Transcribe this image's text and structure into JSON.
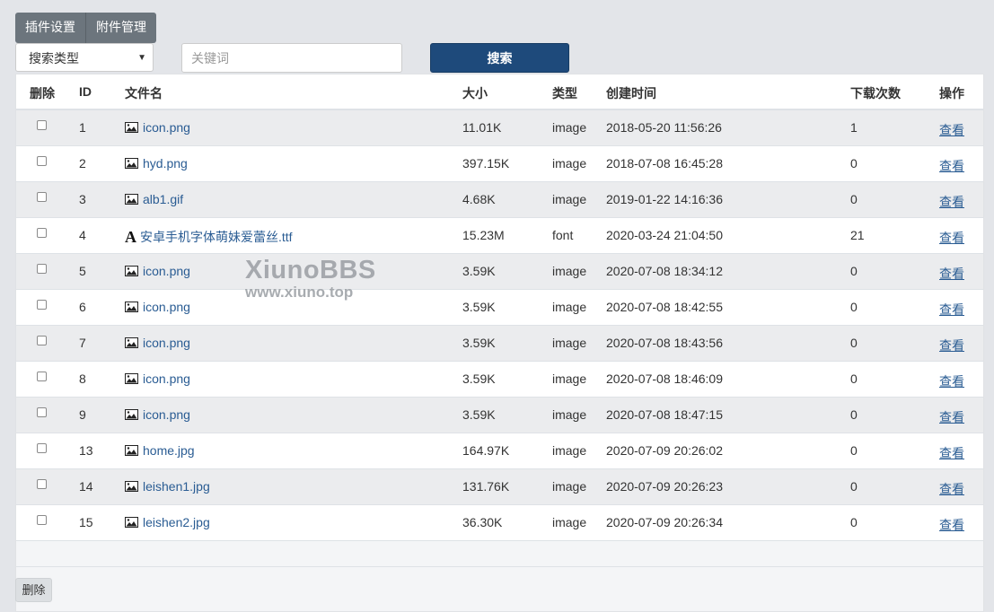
{
  "tabs": [
    "插件设置",
    "附件管理"
  ],
  "search": {
    "type_value": "搜索类型",
    "keyword_placeholder": "关键词",
    "button_label": "搜索"
  },
  "columns": [
    "删除",
    "ID",
    "文件名",
    "大小",
    "类型",
    "创建时间",
    "下载次数",
    "操作"
  ],
  "rows": [
    {
      "id": "1",
      "icon": "image-icon",
      "name": "icon.png",
      "size": "11.01K",
      "type": "image",
      "created": "2018-05-20 11:56:26",
      "downloads": "1",
      "action": "查看"
    },
    {
      "id": "2",
      "icon": "image-icon",
      "name": "hyd.png",
      "size": "397.15K",
      "type": "image",
      "created": "2018-07-08 16:45:28",
      "downloads": "0",
      "action": "查看"
    },
    {
      "id": "3",
      "icon": "image-icon",
      "name": "alb1.gif",
      "size": "4.68K",
      "type": "image",
      "created": "2019-01-22 14:16:36",
      "downloads": "0",
      "action": "查看"
    },
    {
      "id": "4",
      "icon": "font-icon",
      "name": "安卓手机字体萌妹爱蕾丝.ttf",
      "size": "15.23M",
      "type": "font",
      "created": "2020-03-24 21:04:50",
      "downloads": "21",
      "action": "查看"
    },
    {
      "id": "5",
      "icon": "image-icon",
      "name": "icon.png",
      "size": "3.59K",
      "type": "image",
      "created": "2020-07-08 18:34:12",
      "downloads": "0",
      "action": "查看"
    },
    {
      "id": "6",
      "icon": "image-icon",
      "name": "icon.png",
      "size": "3.59K",
      "type": "image",
      "created": "2020-07-08 18:42:55",
      "downloads": "0",
      "action": "查看"
    },
    {
      "id": "7",
      "icon": "image-icon",
      "name": "icon.png",
      "size": "3.59K",
      "type": "image",
      "created": "2020-07-08 18:43:56",
      "downloads": "0",
      "action": "查看"
    },
    {
      "id": "8",
      "icon": "image-icon",
      "name": "icon.png",
      "size": "3.59K",
      "type": "image",
      "created": "2020-07-08 18:46:09",
      "downloads": "0",
      "action": "查看"
    },
    {
      "id": "9",
      "icon": "image-icon",
      "name": "icon.png",
      "size": "3.59K",
      "type": "image",
      "created": "2020-07-08 18:47:15",
      "downloads": "0",
      "action": "查看"
    },
    {
      "id": "13",
      "icon": "image-icon",
      "name": "home.jpg",
      "size": "164.97K",
      "type": "image",
      "created": "2020-07-09 20:26:02",
      "downloads": "0",
      "action": "查看"
    },
    {
      "id": "14",
      "icon": "image-icon",
      "name": "leishen1.jpg",
      "size": "131.76K",
      "type": "image",
      "created": "2020-07-09 20:26:23",
      "downloads": "0",
      "action": "查看"
    },
    {
      "id": "15",
      "icon": "image-icon",
      "name": "leishen2.jpg",
      "size": "36.30K",
      "type": "image",
      "created": "2020-07-09 20:26:34",
      "downloads": "0",
      "action": "查看"
    }
  ],
  "delete_button": "删除",
  "watermark": {
    "line1": "XiunoBBS",
    "line2": "www.xiuno.top"
  },
  "colors": {
    "primary": "#1e4a7b",
    "link": "#2a5c93",
    "tab_bg": "#6c757d",
    "page_bg": "#e3e5e9"
  }
}
